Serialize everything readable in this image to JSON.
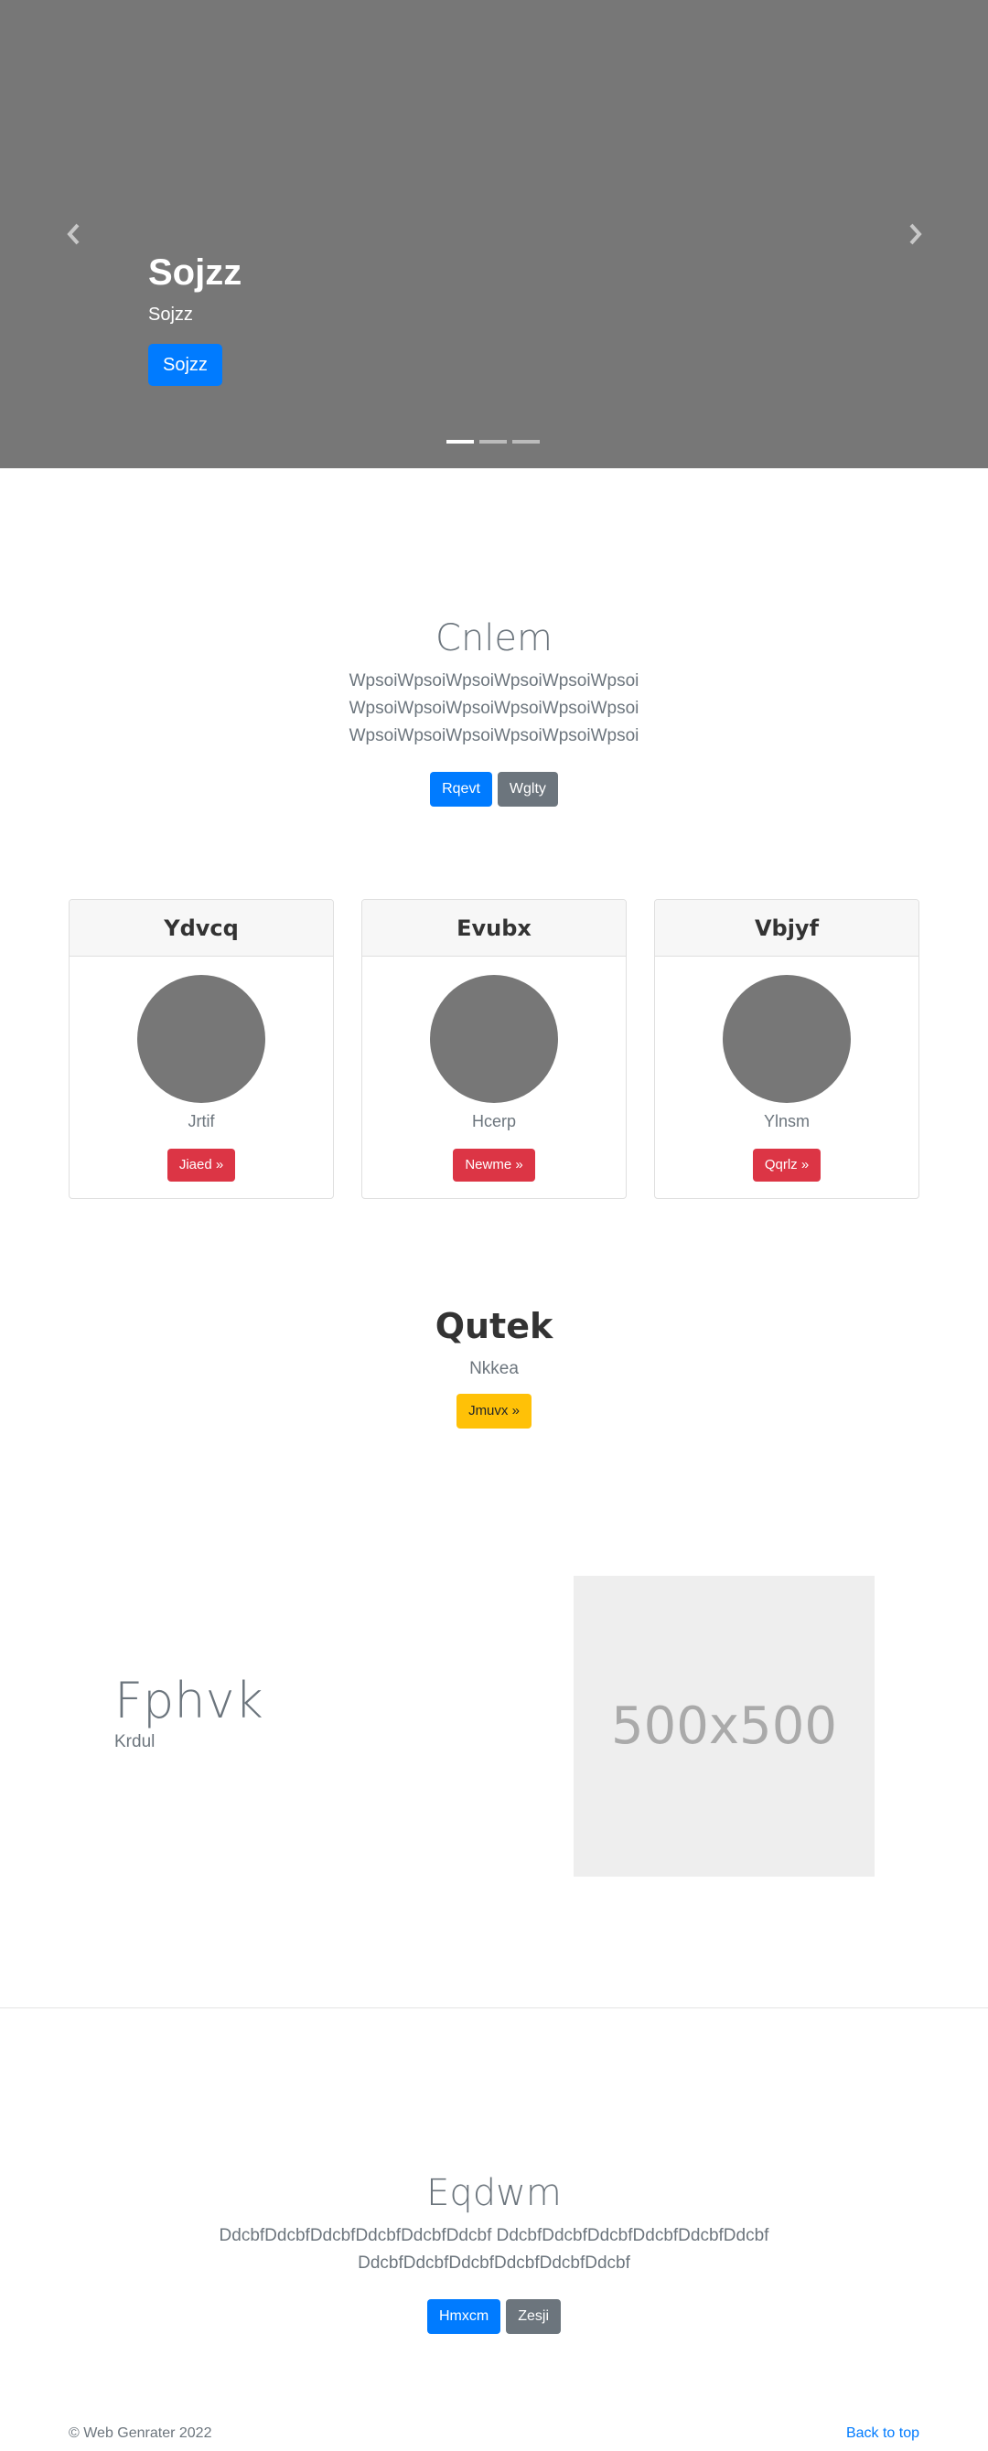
{
  "hero": {
    "title": "Sojzz",
    "subtitle": "Sojzz",
    "button": "Sojzz",
    "indicators": 3,
    "active_indicator": 0,
    "background": "#777777"
  },
  "intro": {
    "title": "Cnlem",
    "lines": [
      "WpsoiWpsoiWpsoiWpsoiWpsoiWpsoi",
      "WpsoiWpsoiWpsoiWpsoiWpsoiWpsoi",
      "WpsoiWpsoiWpsoiWpsoiWpsoiWpsoi"
    ],
    "primary_button": "Rqevt",
    "secondary_button": "Wglty"
  },
  "cards": [
    {
      "header": "Ydvcq",
      "text": "Jrtif",
      "button": "Jiaed »"
    },
    {
      "header": "Evubx",
      "text": "Hcerp",
      "button": "Newme »"
    },
    {
      "header": "Vbjyf",
      "text": "Ylnsm",
      "button": "Qqrlz »"
    }
  ],
  "center": {
    "title": "Qutek",
    "subtitle": "Nkkea",
    "button": "Jmuvx »"
  },
  "feature": {
    "title": "Fphvk",
    "subtitle": "Krdul",
    "placeholder_text": "500x500"
  },
  "bottom": {
    "title": "Eqdwm",
    "lines": [
      "DdcbfDdcbfDdcbfDdcbfDdcbfDdcbf DdcbfDdcbfDdcbfDdcbfDdcbfDdcbf",
      "DdcbfDdcbfDdcbfDdcbfDdcbfDdcbf"
    ],
    "primary_button": "Hmxcm",
    "secondary_button": "Zesji"
  },
  "footer": {
    "copyright": "© Web Genrater 2022",
    "back_to_top": "Back to top"
  },
  "colors": {
    "primary": "#007bff",
    "secondary": "#6c757d",
    "danger": "#dc3545",
    "warning": "#ffc107"
  }
}
